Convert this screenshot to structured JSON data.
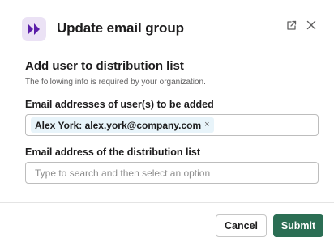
{
  "header": {
    "title": "Update email group",
    "app_icon": "fast-forward-icon",
    "accent": "#5b1fa8",
    "external_icon": "open-external-icon",
    "close_icon": "close-icon"
  },
  "section": {
    "title": "Add user to distribution list",
    "description": "The following info is required by your organization."
  },
  "fields": {
    "users": {
      "label": "Email addresses of user(s) to be added",
      "chips": [
        {
          "label": "Alex York: alex.york@company.com",
          "remove_symbol": "×"
        }
      ]
    },
    "distribution_list": {
      "label": "Email address of the distribution list",
      "placeholder": "Type to search and then select an option",
      "value": ""
    }
  },
  "footer": {
    "cancel_label": "Cancel",
    "submit_label": "Submit",
    "submit_color": "#2b6e54"
  }
}
